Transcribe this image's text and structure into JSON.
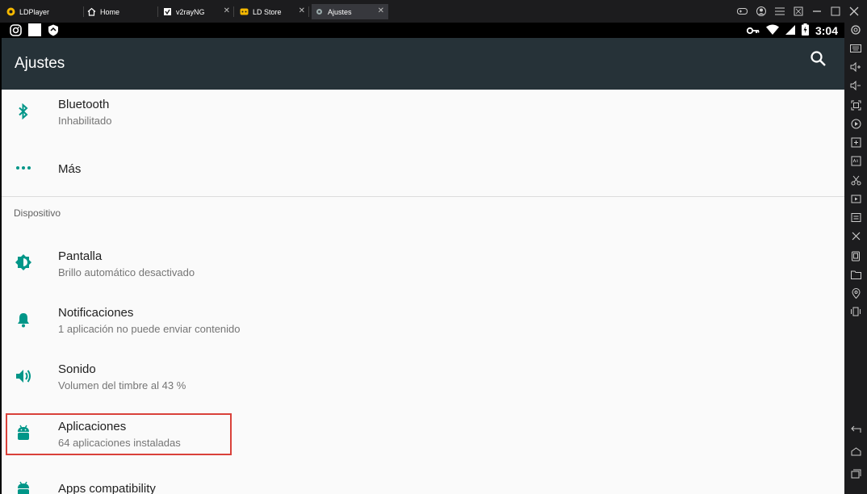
{
  "emulator": {
    "tabs": [
      {
        "label": "LDPlayer",
        "icon": "ldplayer-logo-icon"
      },
      {
        "label": "Home",
        "icon": "home-icon"
      },
      {
        "label": "v2rayNG",
        "icon": "v2rayng-icon"
      },
      {
        "label": "LD Store",
        "icon": "ld-store-icon"
      },
      {
        "label": "Ajustes",
        "icon": "settings-gear-icon"
      }
    ]
  },
  "statusbar": {
    "time": "3:04"
  },
  "appbar": {
    "title": "Ajustes"
  },
  "settings": {
    "bluetooth": {
      "title": "Bluetooth",
      "subtitle": "Inhabilitado"
    },
    "mas": {
      "title": "Más"
    },
    "section_dispositivo": "Dispositivo",
    "pantalla": {
      "title": "Pantalla",
      "subtitle": "Brillo automático desactivado"
    },
    "notificaciones": {
      "title": "Notificaciones",
      "subtitle": "1 aplicación no puede enviar contenido"
    },
    "sonido": {
      "title": "Sonido",
      "subtitle": "Volumen del timbre al 43 %"
    },
    "aplicaciones": {
      "title": "Aplicaciones",
      "subtitle": "64 aplicaciones instaladas"
    },
    "apps_compat": {
      "title": "Apps compatibility"
    }
  },
  "colors": {
    "accent": "#009688",
    "appbar": "#263238",
    "highlight": "#d9413a"
  }
}
